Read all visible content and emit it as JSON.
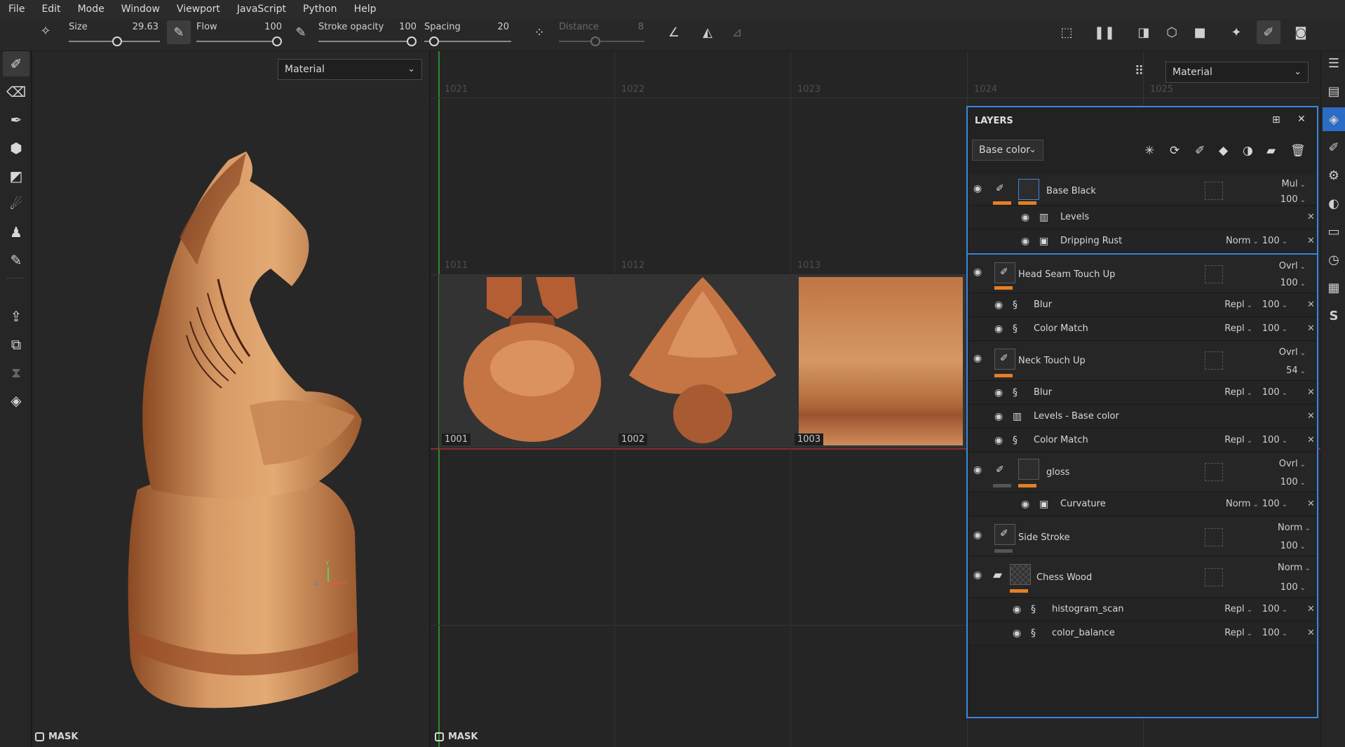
{
  "menu": [
    "File",
    "Edit",
    "Mode",
    "Window",
    "Viewport",
    "JavaScript",
    "Python",
    "Help"
  ],
  "toolbar": {
    "size_label": "Size",
    "size_value": "29.63",
    "flow_label": "Flow",
    "flow_value": "100",
    "stroke_opacity_label": "Stroke opacity",
    "stroke_opacity_value": "100",
    "spacing_label": "Spacing",
    "spacing_value": "20",
    "distance_label": "Distance",
    "distance_value": "8"
  },
  "viewport3d": {
    "channel": "Material",
    "mask_label": "MASK",
    "axis_y": "Y",
    "axis_z": "Z",
    "axis_x": "X"
  },
  "view2d": {
    "channel": "Material",
    "mask_label": "MASK",
    "udims_top": [
      "1021",
      "1022",
      "1023",
      "1024",
      "1025"
    ],
    "udims_mid": [
      "1011",
      "1012",
      "1013"
    ],
    "udims_tiles": [
      "1001",
      "1002",
      "1003"
    ]
  },
  "layers": {
    "title": "LAYERS",
    "channel": "Base color",
    "rows": [
      {
        "name": "Base Black",
        "blend": "Mul",
        "opacity": "100"
      },
      {
        "name": "Levels"
      },
      {
        "name": "Dripping Rust",
        "blend": "Norm",
        "opacity": "100"
      },
      {
        "name": "Head Seam Touch Up",
        "blend": "Ovrl",
        "opacity": "100"
      },
      {
        "name": "Blur",
        "blend": "Repl",
        "opacity": "100"
      },
      {
        "name": "Color Match",
        "blend": "Repl",
        "opacity": "100"
      },
      {
        "name": "Neck Touch Up",
        "blend": "Ovrl",
        "opacity": "54"
      },
      {
        "name": "Blur",
        "blend": "Repl",
        "opacity": "100"
      },
      {
        "name": "Levels - Base color"
      },
      {
        "name": "Color Match",
        "blend": "Repl",
        "opacity": "100"
      },
      {
        "name": "gloss",
        "blend": "Ovrl",
        "opacity": "100"
      },
      {
        "name": "Curvature",
        "blend": "Norm",
        "opacity": "100"
      },
      {
        "name": "Side Stroke",
        "blend": "Norm",
        "opacity": "100"
      },
      {
        "name": "Chess Wood",
        "blend": "Norm",
        "opacity": "100"
      },
      {
        "name": "histogram_scan",
        "blend": "Repl",
        "opacity": "100"
      },
      {
        "name": "color_balance",
        "blend": "Repl",
        "opacity": "100"
      }
    ]
  },
  "colors": {
    "accent": "#3b86e0",
    "layer_bar": "#e57e26",
    "wood": "#c9834f"
  }
}
